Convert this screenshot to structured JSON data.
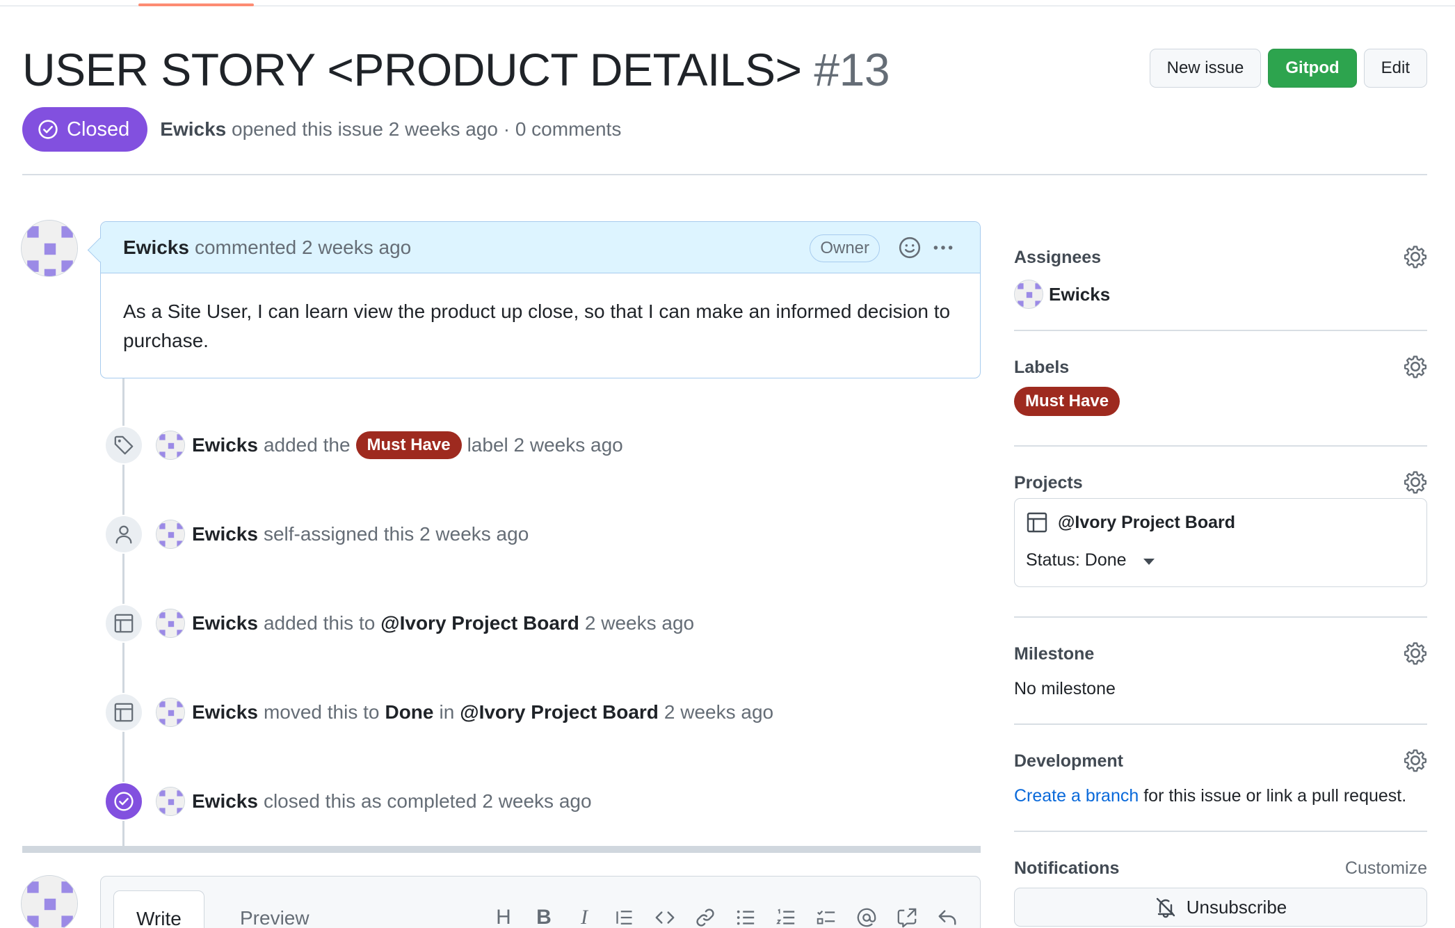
{
  "issue": {
    "title": "USER STORY <PRODUCT DETAILS>",
    "number": "#13",
    "state": "Closed",
    "author": "Ewicks",
    "meta": "opened this issue 2 weeks ago · 0 comments"
  },
  "header_actions": {
    "new_issue": "New issue",
    "gitpod": "Gitpod",
    "edit": "Edit"
  },
  "comment": {
    "author": "Ewicks",
    "when": "commented 2 weeks ago",
    "role": "Owner",
    "body": "As a Site User, I can learn view the product up close, so that I can make an informed decision to purchase."
  },
  "events": [
    {
      "icon": "tag-icon",
      "actor": "Ewicks",
      "pre": "added the",
      "label": "Must Have",
      "post": "label 2 weeks ago"
    },
    {
      "icon": "person-icon",
      "actor": "Ewicks",
      "pre": "self-assigned this 2 weeks ago"
    },
    {
      "icon": "project-icon",
      "actor": "Ewicks",
      "pre": "added this to",
      "project": "@Ivory Project Board",
      "post": "2 weeks ago"
    },
    {
      "icon": "project-icon",
      "actor": "Ewicks",
      "pre": "moved this to",
      "column": "Done",
      "mid": "in",
      "project": "@Ivory Project Board",
      "post": "2 weeks ago"
    },
    {
      "icon": "check-circle-icon",
      "actor": "Ewicks",
      "pre": "closed this as completed 2 weeks ago"
    }
  ],
  "composer": {
    "tabs": [
      "Write",
      "Preview"
    ],
    "toolbar": [
      "heading-icon",
      "bold-icon",
      "italic-icon",
      "quote-icon",
      "code-icon",
      "link-icon",
      "bulleted-list-icon",
      "numbered-list-icon",
      "task-list-icon",
      "mention-icon",
      "cross-reference-icon",
      "reply-icon"
    ],
    "toolbar_glyphs": {
      "heading": "H",
      "bold": "B",
      "italic": "I"
    }
  },
  "sidebar": {
    "assignees": {
      "heading": "Assignees",
      "user": "Ewicks"
    },
    "labels": {
      "heading": "Labels",
      "label": "Must Have"
    },
    "projects": {
      "heading": "Projects",
      "project": "@Ivory Project Board",
      "status": "Status: Done"
    },
    "milestone": {
      "heading": "Milestone",
      "value": "No milestone"
    },
    "development": {
      "heading": "Development",
      "link": "Create a branch",
      "rest": "for this issue or link a pull request."
    },
    "notifications": {
      "heading": "Notifications",
      "customize": "Customize",
      "button": "Unsubscribe"
    }
  },
  "colors": {
    "closed_purple": "#8250df",
    "gitpod_green": "#2da44e",
    "label_red": "#9e2a1f",
    "link_blue": "#0969da",
    "comment_header_bg": "#ddf4ff"
  }
}
